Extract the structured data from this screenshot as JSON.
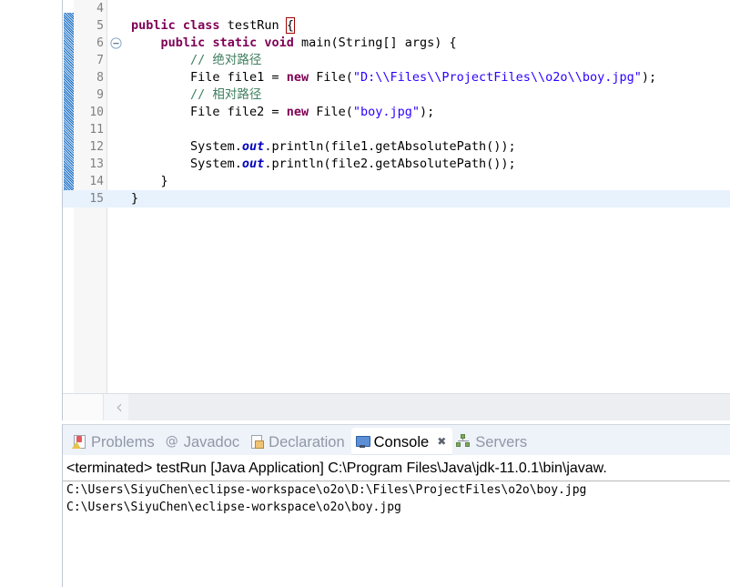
{
  "editor": {
    "first_line_number": 4,
    "current_line_number": 15,
    "lines": [
      {
        "num": "4",
        "segments": []
      },
      {
        "num": "5",
        "segments": [
          {
            "t": "public",
            "c": "kw"
          },
          {
            "t": " ",
            "c": ""
          },
          {
            "t": "class",
            "c": "kw"
          },
          {
            "t": " testRun ",
            "c": ""
          },
          {
            "t": "{",
            "c": "brkt-match"
          }
        ]
      },
      {
        "num": "6",
        "fold": true,
        "segments": [
          {
            "t": "    ",
            "c": ""
          },
          {
            "t": "public",
            "c": "kw"
          },
          {
            "t": " ",
            "c": ""
          },
          {
            "t": "static",
            "c": "kw"
          },
          {
            "t": " ",
            "c": ""
          },
          {
            "t": "void",
            "c": "kw"
          },
          {
            "t": " main(String[] args) {",
            "c": ""
          }
        ]
      },
      {
        "num": "7",
        "segments": [
          {
            "t": "        ",
            "c": ""
          },
          {
            "t": "// 绝对路径",
            "c": "cmt"
          }
        ]
      },
      {
        "num": "8",
        "segments": [
          {
            "t": "        File file1 = ",
            "c": ""
          },
          {
            "t": "new",
            "c": "kw"
          },
          {
            "t": " File(",
            "c": ""
          },
          {
            "t": "\"D:\\\\Files\\\\ProjectFiles\\\\o2o\\\\boy.jpg\"",
            "c": "str"
          },
          {
            "t": ");",
            "c": ""
          }
        ]
      },
      {
        "num": "9",
        "segments": [
          {
            "t": "        ",
            "c": ""
          },
          {
            "t": "// 相对路径",
            "c": "cmt"
          }
        ]
      },
      {
        "num": "10",
        "segments": [
          {
            "t": "        File file2 = ",
            "c": ""
          },
          {
            "t": "new",
            "c": "kw"
          },
          {
            "t": " File(",
            "c": ""
          },
          {
            "t": "\"boy.jpg\"",
            "c": "str"
          },
          {
            "t": ");",
            "c": ""
          }
        ]
      },
      {
        "num": "11",
        "segments": []
      },
      {
        "num": "12",
        "segments": [
          {
            "t": "        System.",
            "c": ""
          },
          {
            "t": "out",
            "c": "fld"
          },
          {
            "t": ".println(file1.getAbsolutePath());",
            "c": ""
          }
        ]
      },
      {
        "num": "13",
        "segments": [
          {
            "t": "        System.",
            "c": ""
          },
          {
            "t": "out",
            "c": "fld"
          },
          {
            "t": ".println(file2.getAbsolutePath());",
            "c": ""
          }
        ]
      },
      {
        "num": "14",
        "segments": [
          {
            "t": "    }",
            "c": ""
          }
        ]
      },
      {
        "num": "15",
        "current": true,
        "segments": [
          {
            "t": "}",
            "c": ""
          }
        ]
      }
    ],
    "scroll_left_arrow": "‹"
  },
  "bottom_panel": {
    "tabs": [
      {
        "label": "Problems",
        "icon": "problems-icon",
        "active": false,
        "closable": false
      },
      {
        "label": "Javadoc",
        "icon": "javadoc-at-icon",
        "active": false,
        "closable": false
      },
      {
        "label": "Declaration",
        "icon": "declaration-icon",
        "active": false,
        "closable": false
      },
      {
        "label": "Console",
        "icon": "console-icon",
        "active": true,
        "closable": true,
        "close_glyph": "✖"
      },
      {
        "label": "Servers",
        "icon": "servers-icon",
        "active": false,
        "closable": false
      }
    ],
    "console": {
      "terminated_header": "<terminated> testRun [Java Application] C:\\Program Files\\Java\\jdk-11.0.1\\bin\\javaw.",
      "output_lines": [
        "C:\\Users\\SiyuChen\\eclipse-workspace\\o2o\\D:\\Files\\ProjectFiles\\o2o\\boy.jpg",
        "C:\\Users\\SiyuChen\\eclipse-workspace\\o2o\\boy.jpg"
      ]
    }
  },
  "colors": {
    "keyword": "#7f0055",
    "comment": "#3f7f5f",
    "string": "#2a00ff",
    "static_field": "#0000c0",
    "current_line_bg": "#e8f2fd",
    "change_bar": "#1a6fc4",
    "tab_inactive_text": "#9097a6",
    "panel_bg": "#eef2f9"
  }
}
